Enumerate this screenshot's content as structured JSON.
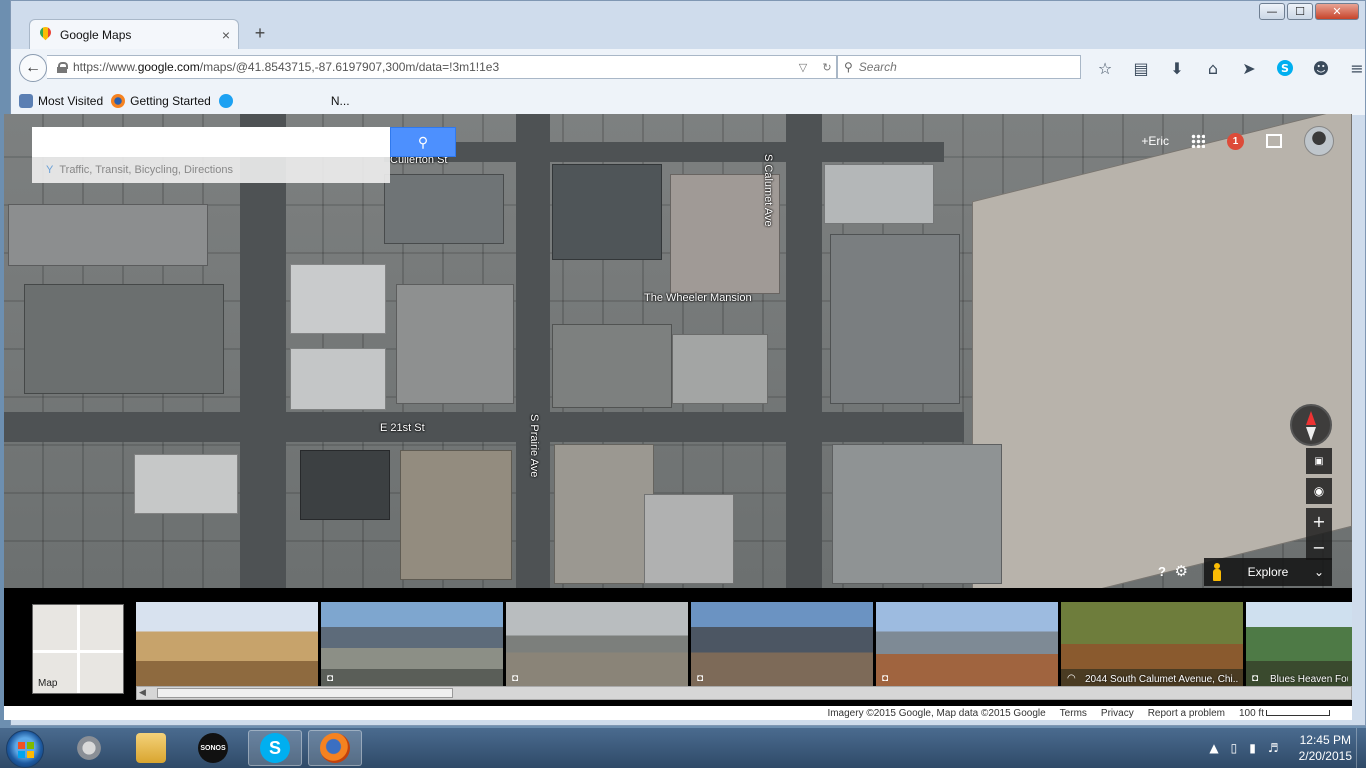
{
  "window": {
    "controls": [
      "—",
      "☐",
      "✕"
    ]
  },
  "tab": {
    "title": "Google Maps",
    "close": "×",
    "new": "+"
  },
  "nav": {
    "back": "←",
    "url_prefix": "https://www.",
    "url_host": "google.com",
    "url_rest": "/maps/@41.8543715,-87.6197907,300m/data=!3m1!1e3",
    "dropdown": "▽",
    "reload": "↻",
    "search_placeholder": "Search"
  },
  "toolbar": [
    "☆",
    "▤",
    "⬇",
    "⌂",
    "➤",
    "S",
    "☻",
    "≡"
  ],
  "bookmarks": {
    "most_visited": "Most Visited",
    "getting_started": "Getting Started",
    "ellipsis": "N..."
  },
  "maps": {
    "search_value": "",
    "hint": "Traffic, Transit, Bicycling, Directions",
    "account_name": "+Eric",
    "notifications": "1",
    "place_label": "The Wheeler Mansion",
    "street_labels": [
      "S Calumet Ave",
      "E 21st St",
      "S Prairie Ave",
      "Cullerton St"
    ],
    "zoom_in": "+",
    "zoom_out": "−",
    "help": "?",
    "settings": "⚙",
    "explore": "Explore",
    "explore_chevron": "⌄"
  },
  "strip": {
    "minimap_label": "Map",
    "photos": [
      {
        "caption": "",
        "icon": ""
      },
      {
        "caption": "",
        "icon": "◘"
      },
      {
        "caption": "",
        "icon": "◘"
      },
      {
        "caption": "",
        "icon": "◘"
      },
      {
        "caption": "",
        "icon": "◘"
      },
      {
        "caption": "2044 South Calumet Avenue, Chi...",
        "icon": "◠"
      },
      {
        "caption": "Blues Heaven Four",
        "icon": "◘"
      }
    ]
  },
  "footer": {
    "imagery": "Imagery ©2015 Google, Map data ©2015 Google",
    "terms": "Terms",
    "privacy": "Privacy",
    "report": "Report a problem",
    "scale": "100 ft"
  },
  "taskbar": {
    "sonos": "SONOS",
    "skype": "S",
    "time": "12:45 PM",
    "date": "2/20/2015"
  },
  "colors": {
    "maps_blue": "#4d90fe",
    "taskbar": "#2f4a68",
    "notify_red": "#dd4b39"
  }
}
